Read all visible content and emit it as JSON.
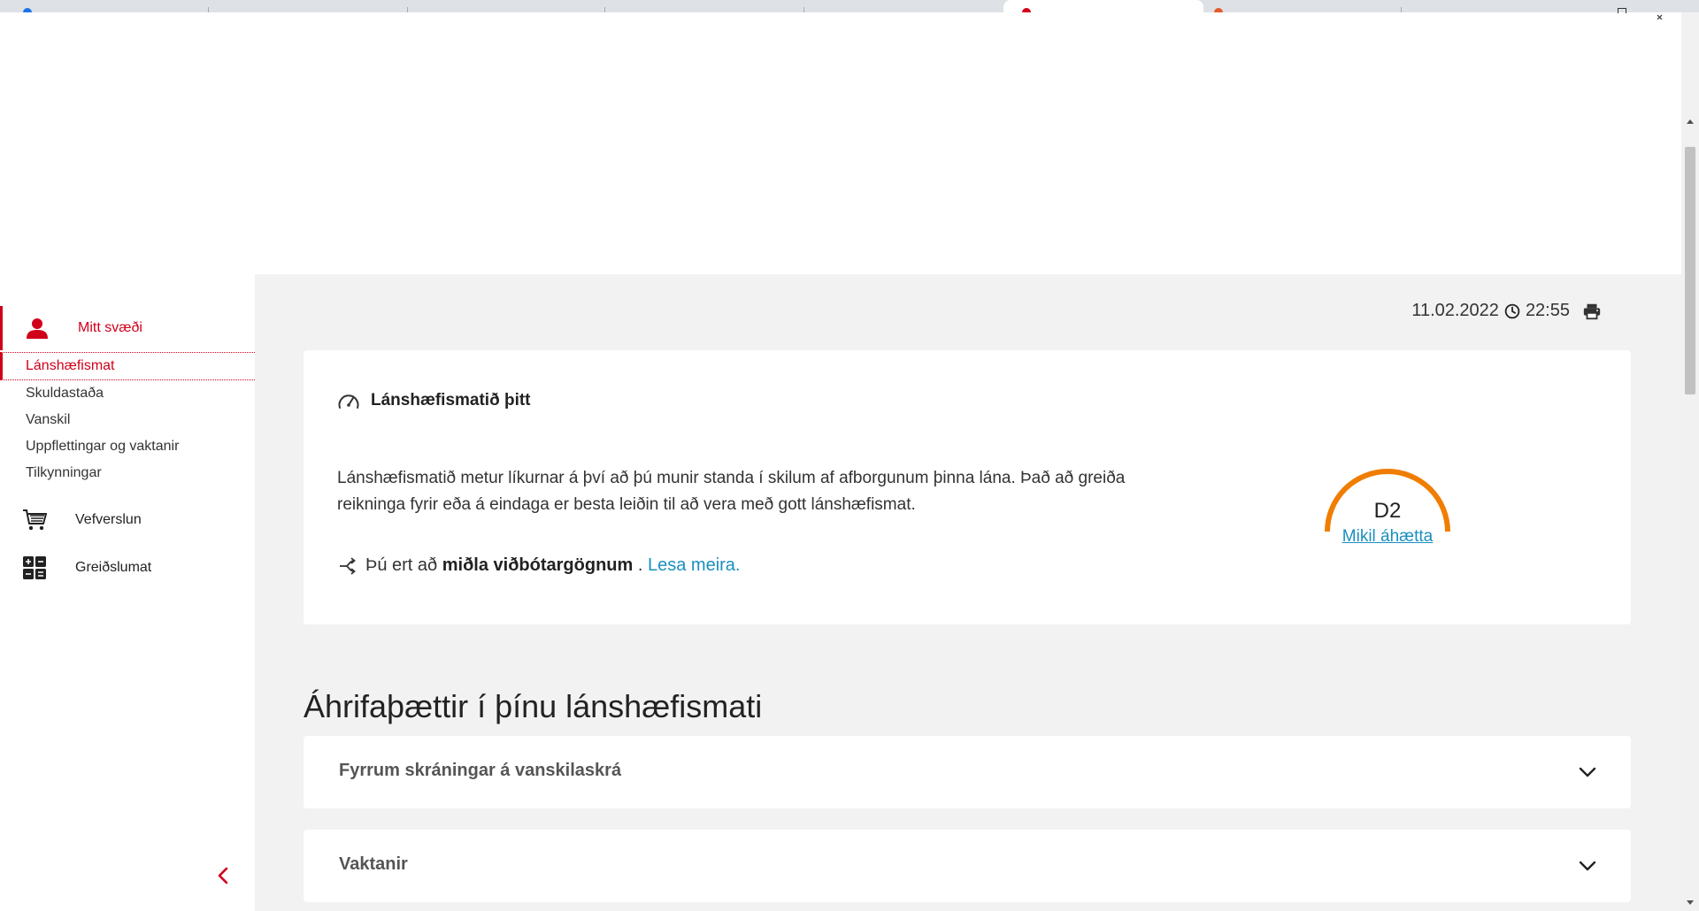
{
  "sidebar": {
    "mitt_svaedi": "Mitt svæði",
    "subitems": [
      "Lánshæfismat",
      "Skuldastaða",
      "Vanskil",
      "Uppflettingar og vaktanir",
      "Tilkynningar"
    ],
    "vefverslun": "Vefverslun",
    "greidslumat": "Greiðslumat"
  },
  "header": {
    "date": "11.02.2022",
    "time": "22:55"
  },
  "card": {
    "title": "Lánshæfismatið þitt",
    "description": "Lánshæfismatið metur líkurnar á því að þú munir standa í skilum af afborgunum þinna lána. Það að greiða reikninga fyrir eða á eindaga er besta leiðin til að vera með gott lánshæfismat.",
    "share_prefix": "Þú ert að",
    "share_bold": "miðla viðbótargögnum",
    "share_suffix": ".",
    "read_more": "Lesa meira.",
    "score": "D2",
    "risk_label": "Mikil áhætta"
  },
  "section_title": "Áhrifaþættir í þínu lánshæfismati",
  "accordions": [
    "Fyrrum skráningar á vanskilaskrá",
    "Vaktanir"
  ],
  "icons": {
    "user": "user-icon",
    "cart": "cart-icon",
    "calculator": "calculator-icon",
    "clock": "clock-icon",
    "print": "print-icon",
    "gauge": "gauge-icon",
    "share": "share-icon",
    "chevron": "chevron-down-icon",
    "collapse": "chevron-left-icon"
  },
  "colors": {
    "brand_red": "#d0011b",
    "link_blue": "#1a8fc0",
    "gauge_orange": "#f07d00",
    "main_bg": "#f2f2f2"
  }
}
